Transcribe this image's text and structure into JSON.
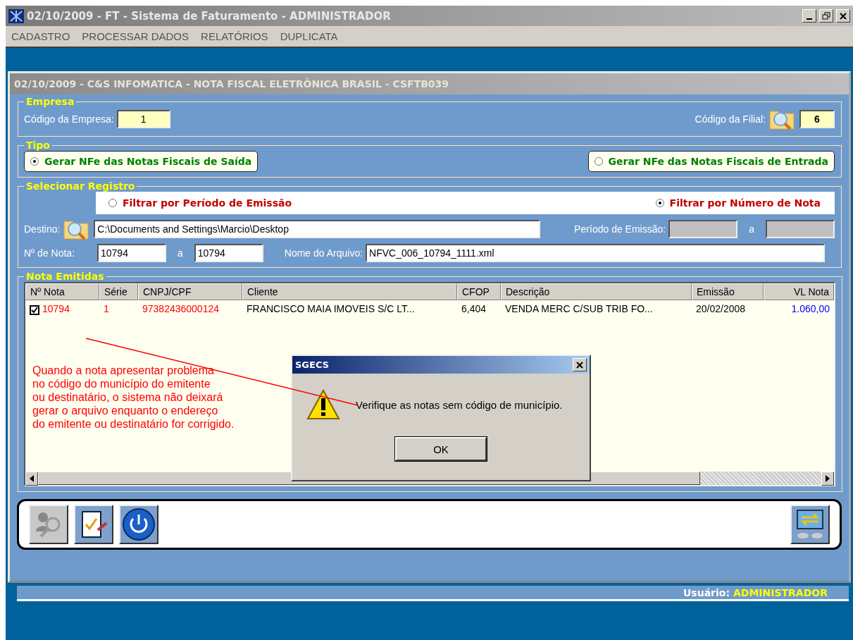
{
  "window": {
    "title": "02/10/2009 - FT - Sistema de Faturamento - ADMINISTRADOR"
  },
  "menu": [
    "CADASTRO",
    "PROCESSAR DADOS",
    "RELATÓRIOS",
    "DUPLICATA"
  ],
  "form": {
    "title": "02/10/2009 - C&S INFOMATICA - NOTA FISCAL ELETRÔNICA BRASIL - CSFTB039"
  },
  "empresa": {
    "legend": "Empresa",
    "codigo_empresa_label": "Código da Empresa:",
    "codigo_empresa": "1",
    "codigo_filial_label": "Código da Filial:",
    "codigo_filial": "6"
  },
  "tipo": {
    "legend": "Tipo",
    "options": [
      {
        "label": "Gerar NFe das Notas Fiscais de Saída",
        "selected": true
      },
      {
        "label": "Gerar NFe das Notas Fiscais de Entrada",
        "selected": false
      }
    ]
  },
  "selecionar": {
    "legend": "Selecionar Registro",
    "filters": [
      {
        "label": "Filtrar por Período de Emissão",
        "selected": false
      },
      {
        "label": "Filtrar por Número de Nota",
        "selected": true
      }
    ],
    "destino_label": "Destino:",
    "destino": "C:\\Documents and Settings\\Marcio\\Desktop",
    "periodo_label": "Período de Emissão:",
    "periodo_sep": "a",
    "periodo_fields": [
      {
        "disabled": true
      },
      {
        "disabled": true
      }
    ],
    "nota_label": "Nº de Nota:",
    "nota_from": "10794",
    "nota_sep": "a",
    "nota_to": "10794",
    "arquivo_label": "Nome do Arquivo:",
    "arquivo": "NFVC_006_10794_1111.xml"
  },
  "notas": {
    "legend": "Nota Emitidas",
    "columns": [
      "Nº Nota",
      "Série",
      "CNPJ/CPF",
      "Cliente",
      "CFOP",
      "Descrição",
      "Emissão",
      "VL Nota"
    ],
    "rows": [
      {
        "checked": true,
        "cells": [
          {
            "text": "10794",
            "color": "#ff0000"
          },
          {
            "text": "1",
            "color": "#ff0000"
          },
          {
            "text": "97382436000124",
            "color": "#ff0000"
          },
          {
            "text": "FRANCISCO MAIA IMOVEIS S/C LT...",
            "color": "#000000"
          },
          {
            "text": "6,404",
            "color": "#000000"
          },
          {
            "text": "VENDA MERC C/SUB TRIB FO...",
            "color": "#000000"
          },
          {
            "text": "20/02/2008",
            "color": "#000000"
          },
          {
            "text": "1.060,00",
            "color": "#0000ff"
          }
        ]
      }
    ]
  },
  "annotation": "Quando a nota apresentar problema\nno código do município do emitente\nou destinatário, o sistema não deixará\ngerar o arquivo enquanto o endereço\ndo emitente ou destinatário for corrigido.",
  "dialog": {
    "title": "SGECS",
    "message": "Verifique as notas sem código de município.",
    "button": "OK"
  },
  "toolbar": [
    {
      "kind": "search-user",
      "disabled": true
    },
    {
      "kind": "checklist",
      "disabled": false
    },
    {
      "kind": "power",
      "disabled": false
    },
    {
      "kind": "exchange",
      "disabled": false
    }
  ],
  "status": {
    "label": "Usuário:",
    "user": "ADMINISTRADOR"
  }
}
